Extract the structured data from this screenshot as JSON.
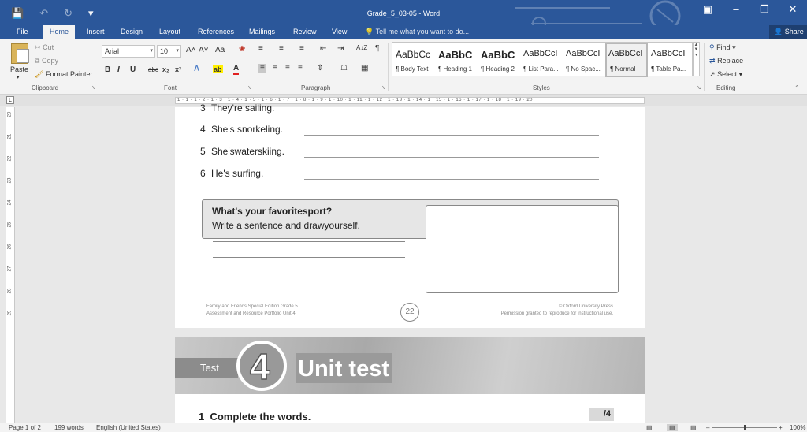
{
  "window": {
    "title": "Grade_5_03-05 - Word",
    "qat": {
      "save_icon": "save-icon",
      "undo_icon": "undo-icon",
      "redo_icon": "redo-icon",
      "customize_icon": "customize-icon"
    },
    "controls": {
      "ribbon_options": "▣",
      "minimize": "–",
      "restore": "❐",
      "close": "✕"
    }
  },
  "tabs": {
    "items": [
      "File",
      "Home",
      "Insert",
      "Design",
      "Layout",
      "References",
      "Mailings",
      "Review",
      "View"
    ],
    "active": "Home",
    "tell_me": "Tell me what you want to do...",
    "share": "Share"
  },
  "ribbon": {
    "clipboard": {
      "paste": "Paste",
      "cut": "Cut",
      "copy": "Copy",
      "format_painter": "Format Painter",
      "label": "Clipboard"
    },
    "font": {
      "name": "Arial",
      "size": "10",
      "label": "Font",
      "bold": "B",
      "italic": "I",
      "underline": "U",
      "strike": "abc",
      "subscript": "x₂",
      "superscript": "x²",
      "grow": "A˄",
      "shrink": "A˅",
      "case": "Aa",
      "effects": "A",
      "highlight": "ab",
      "color": "A"
    },
    "paragraph": {
      "label": "Paragraph",
      "sort": "A↓Z",
      "pilcrow": "¶"
    },
    "styles": {
      "label": "Styles",
      "items": [
        {
          "sample": "AaBbCc",
          "name": "¶ Body Text",
          "bold": false
        },
        {
          "sample": "AaBbC",
          "name": "¶ Heading 1",
          "bold": true
        },
        {
          "sample": "AaBbC",
          "name": "¶ Heading 2",
          "bold": true
        },
        {
          "sample": "AaBbCcI",
          "name": "¶ List Para...",
          "bold": false
        },
        {
          "sample": "AaBbCcI",
          "name": "¶ No Spac...",
          "bold": false
        },
        {
          "sample": "AaBbCcI",
          "name": "¶ Normal",
          "bold": false
        },
        {
          "sample": "AaBbCcI",
          "name": "¶ Table Pa...",
          "bold": false
        }
      ],
      "selected": "¶ Normal"
    },
    "editing": {
      "label": "Editing",
      "find": "Find",
      "replace": "Replace",
      "select": "Select"
    }
  },
  "ruler": {
    "h_ticks": "1 · 1 · 1 · 2 · 1 · 3 · 1 · 4 · 1 · 5 · 1 · 6 · 1 · 7 · 1 · 8 · 1 · 9 · 1 · 10 · 1 · 11 · 1 · 12 · 1 · 13 · 1 · 14 · 1 · 15 · 1 · 16 · 1 · 17 · 1 · 18 · 1 · 19 · 20",
    "v_ticks": [
      "20",
      "21",
      "22",
      "23",
      "24",
      "25",
      "26",
      "27",
      "28",
      "29"
    ]
  },
  "document": {
    "page1": {
      "exercises": [
        {
          "num": "3",
          "text": "They're sailing."
        },
        {
          "num": "4",
          "text": "She's snorkeling."
        },
        {
          "num": "5",
          "text": "She'swaterskiing."
        },
        {
          "num": "6",
          "text": "He's surfing."
        }
      ],
      "sport_question": "What's your favoritesport?",
      "sport_instruction": "Write a sentence and drawyourself.",
      "footer_left": [
        "Family and Friends Special Edition Grade 5",
        "Assessment and Resource Portfolio Unit 4"
      ],
      "page_number": "22",
      "footer_right": [
        "© Oxford University Press",
        "Permission granted to reproduce for instructional use."
      ]
    },
    "page2": {
      "banner_label": "Test",
      "unit_number": "4",
      "unit_title": "Unit test",
      "question_number": "1",
      "question_text": "Complete the words.",
      "score": "/4"
    }
  },
  "status": {
    "page": "Page 1 of 2",
    "words": "199 words",
    "language": "English (United States)",
    "zoom": "100%",
    "zoom_minus": "–",
    "zoom_plus": "+"
  },
  "colors": {
    "word_blue": "#2b579a",
    "ribbon_bg": "#f3f3f3"
  }
}
